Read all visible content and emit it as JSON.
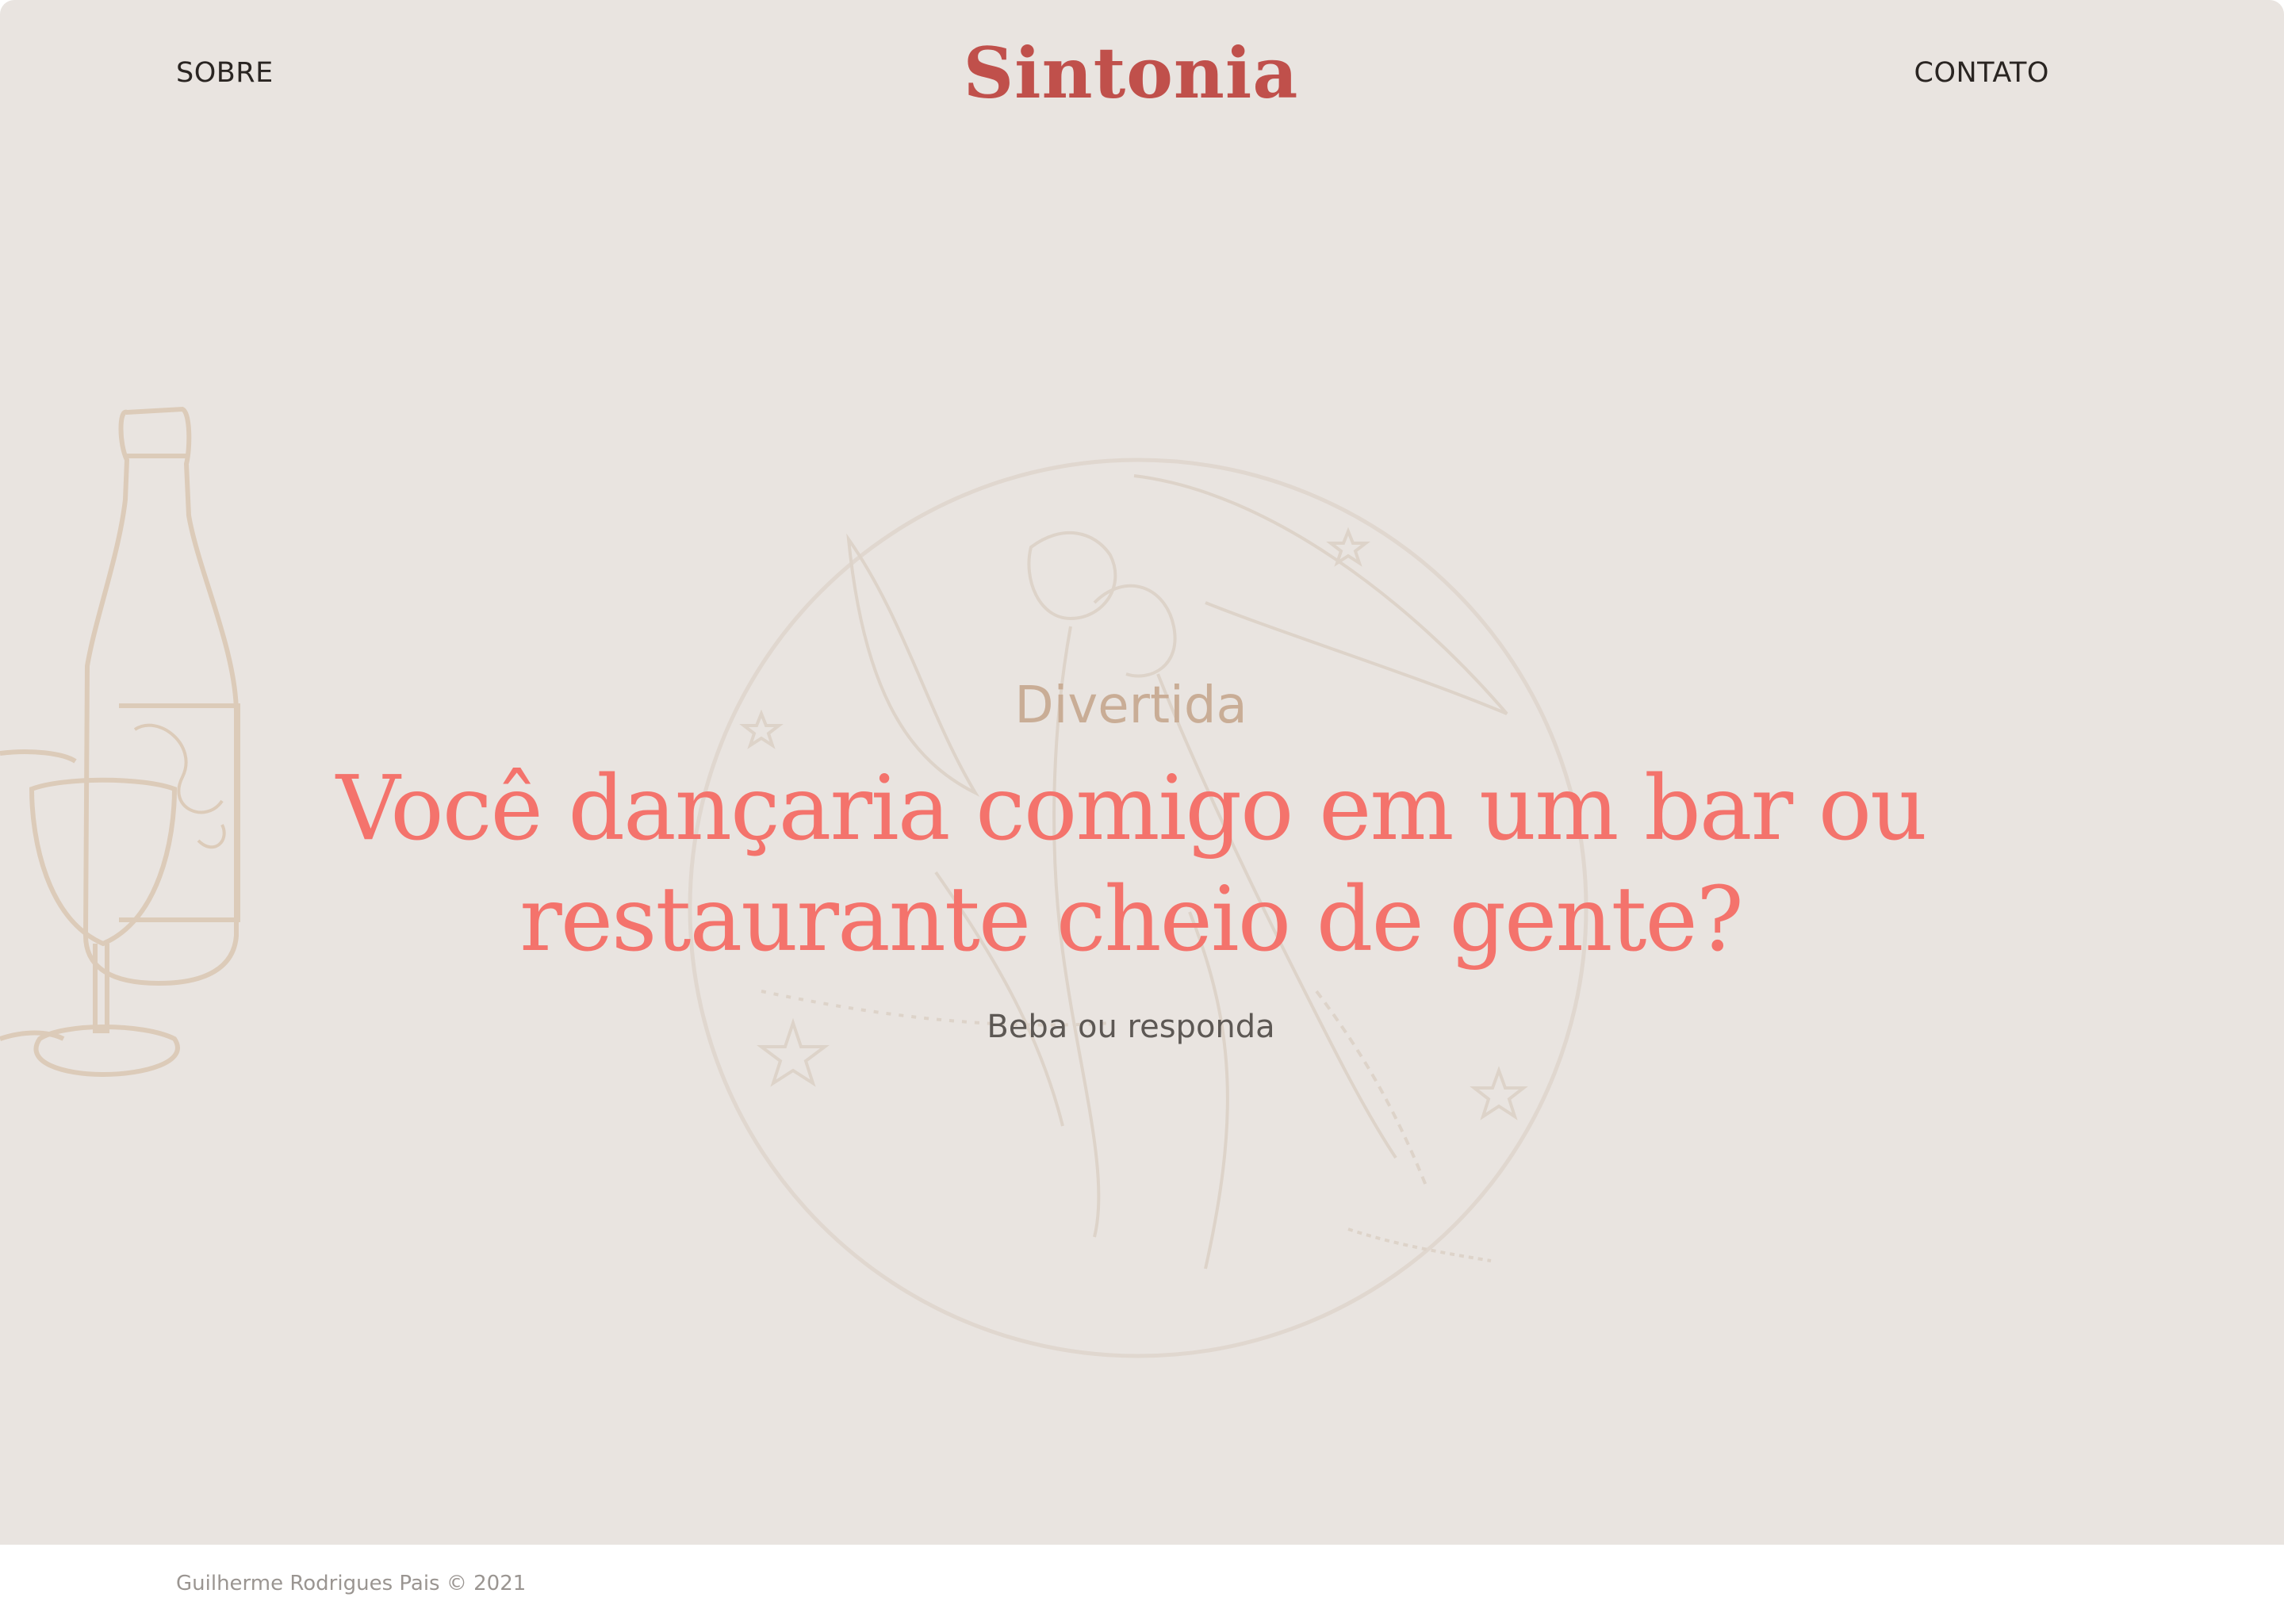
{
  "nav": {
    "about_label": "SOBRE",
    "contact_label": "CONTATO"
  },
  "brand": {
    "name": "Sintonia"
  },
  "card": {
    "category": "Divertida",
    "question": "Você dançaria comigo em um bar ou restaurante cheio de gente?",
    "hint": "Beba ou responda"
  },
  "footer": {
    "credit": "Guilherme Rodrigues Pais © 2021"
  },
  "colors": {
    "background": "#e9e4e0",
    "brand": "#c0504b",
    "question": "#f4736c",
    "category": "#c9ad96",
    "illustration": "#ddd0c4"
  }
}
